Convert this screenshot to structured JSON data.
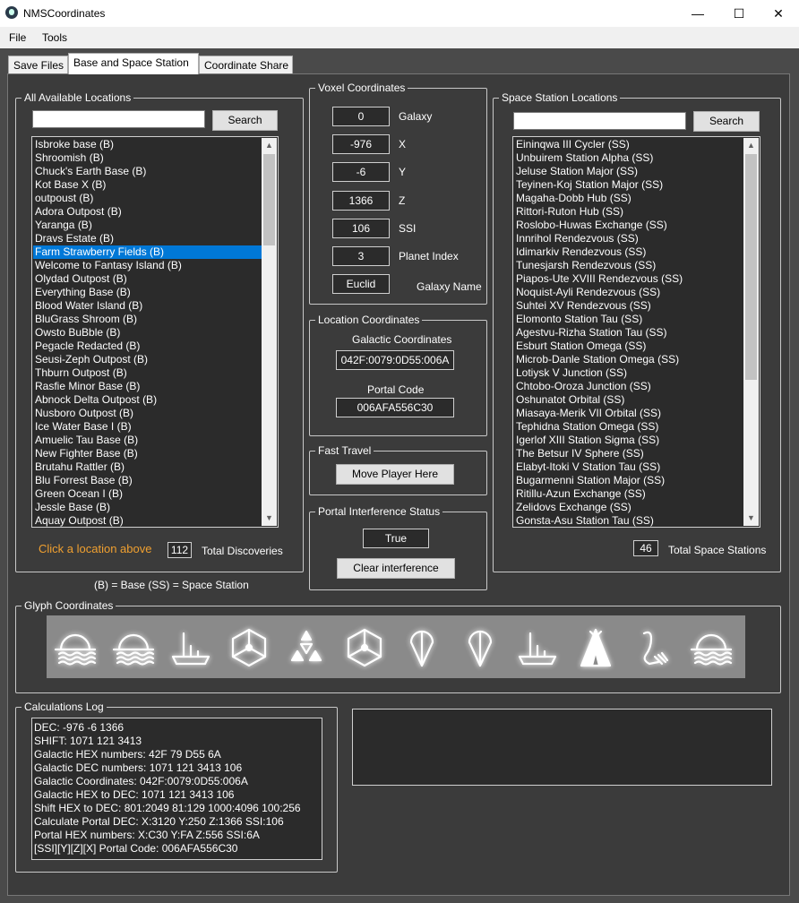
{
  "window": {
    "title": "NMSCoordinates",
    "minimize": "—",
    "maximize": "☐",
    "close": "✕"
  },
  "menu": {
    "file": "File",
    "tools": "Tools"
  },
  "tabs": [
    {
      "label": "Save Files"
    },
    {
      "label": "Base and Space Station"
    },
    {
      "label": "Coordinate Share"
    }
  ],
  "all_locations": {
    "legend": "All Available Locations",
    "search_value": "",
    "search_label": "Search",
    "items": [
      "Isbroke base (B)",
      "Shroomish (B)",
      "Chuck's Earth Base (B)",
      "Kot Base X (B)",
      "outpoust (B)",
      "Adora Outpost (B)",
      "Yaranga (B)",
      "Dravs Estate (B)",
      "Farm Strawberry Fields (B)",
      "Welcome to Fantasy Island (B)",
      "Olydad Outpost (B)",
      "Everything Base (B)",
      "Blood Water Island (B)",
      "BluGrass Shroom (B)",
      "Owsto BuBble (B)",
      "Pegacle Redacted (B)",
      "Seusi-Zeph Outpost (B)",
      "Thburn Outpost (B)",
      "Rasfie Minor Base (B)",
      "Abnock Delta Outpost (B)",
      "Nusboro Outpost (B)",
      "Ice Water Base I (B)",
      "Amuelic Tau Base (B)",
      "New Fighter Base (B)",
      "Brutahu Rattler (B)",
      "Blu Forrest Base (B)",
      "Green Ocean I (B)",
      "Jessle Base (B)",
      "Aquay Outpost (B)"
    ],
    "selected_index": 8,
    "hint": "Click a location above",
    "total": "112",
    "total_label": "Total Discoveries",
    "legend_note": "(B) = Base  (SS) = Space Station"
  },
  "voxel": {
    "legend": "Voxel Coordinates",
    "fields": [
      {
        "value": "0",
        "label": "Galaxy"
      },
      {
        "value": "-976",
        "label": "X"
      },
      {
        "value": "-6",
        "label": "Y"
      },
      {
        "value": "1366",
        "label": "Z"
      },
      {
        "value": "106",
        "label": "SSI"
      },
      {
        "value": "3",
        "label": "Planet Index"
      },
      {
        "value": "Euclid",
        "label": "Galaxy Name"
      }
    ]
  },
  "location_coords": {
    "legend": "Location Coordinates",
    "galactic_label": "Galactic Coordinates",
    "galactic_value": "042F:0079:0D55:006A",
    "portal_label": "Portal Code",
    "portal_value": "006AFA556C30"
  },
  "fast_travel": {
    "legend": "Fast Travel",
    "button": "Move Player Here"
  },
  "portal_interference": {
    "legend": "Portal Interference Status",
    "value": "True",
    "button": "Clear interference"
  },
  "space_stations": {
    "legend": "Space Station Locations",
    "search_value": "",
    "search_label": "Search",
    "items": [
      "Eininqwa III Cycler (SS)",
      "Unbuirem Station Alpha (SS)",
      "Jeluse Station Major (SS)",
      "Teyinen-Koj Station Major (SS)",
      "Magaha-Dobb Hub (SS)",
      "Rittori-Ruton Hub (SS)",
      "Roslobo-Huwas Exchange (SS)",
      "Innrihol Rendezvous (SS)",
      "Idimarkiv Rendezvous (SS)",
      "Tunesjarsh Rendezvous (SS)",
      "Piapos-Ute XVIII Rendezvous (SS)",
      "Noquist-Ayli Rendezvous (SS)",
      "Suhtei XV Rendezvous (SS)",
      "Elomonto Station Tau (SS)",
      "Agestvu-Rizha Station Tau (SS)",
      "Esburt Station Omega (SS)",
      "Microb-Danle Station Omega (SS)",
      "Lotiysk V Junction (SS)",
      "Chtobo-Oroza Junction (SS)",
      "Oshunatot Orbital (SS)",
      "Miasaya-Merik VII Orbital (SS)",
      "Tephidna Station Omega (SS)",
      "Igerlof XIII Station Sigma (SS)",
      "The Betsur IV Sphere (SS)",
      "Elabyt-Itoki V Station Tau (SS)",
      "Bugarmenni Station Major (SS)",
      "Ritillu-Azun Exchange (SS)",
      "Zelidovs Exchange (SS)",
      "Gonsta-Asu Station Tau (SS)"
    ],
    "total": "46",
    "total_label": "Total Space Stations"
  },
  "glyphs": {
    "legend": "Glyph Coordinates",
    "icons": [
      "sunset-glyph-icon",
      "sunset-glyph-icon",
      "boat-glyph-icon",
      "hexagon-glyph-icon",
      "triangle-glyph-icon",
      "hexagon-glyph-icon",
      "drop-glyph-icon",
      "drop-glyph-icon",
      "boat-glyph-icon",
      "tent-glyph-icon",
      "serpent-glyph-icon",
      "sunset-glyph-icon"
    ]
  },
  "calc_log": {
    "legend": "Calculations Log",
    "lines": [
      "DEC: -976 -6 1366",
      "SHIFT: 1071 121 3413",
      "Galactic HEX numbers: 42F 79 D55 6A",
      "Galactic DEC numbers: 1071 121 3413 106",
      "Galactic Coordinates: 042F:0079:0D55:006A",
      "Galactic HEX to DEC: 1071 121 3413 106",
      "Shift HEX to DEC: 801:2049 81:129 1000:4096 100:256",
      "Calculate Portal DEC: X:3120 Y:250 Z:1366 SSI:106",
      "Portal HEX numbers: X:C30 Y:FA Z:556 SSI:6A",
      "[SSI][Y][Z][X] Portal Code: 006AFA556C30"
    ]
  },
  "colors": {
    "accent_hint": "#f0a030",
    "selection": "#0078d7",
    "panel": "#3b3b3b",
    "field": "#2b2b2b"
  }
}
